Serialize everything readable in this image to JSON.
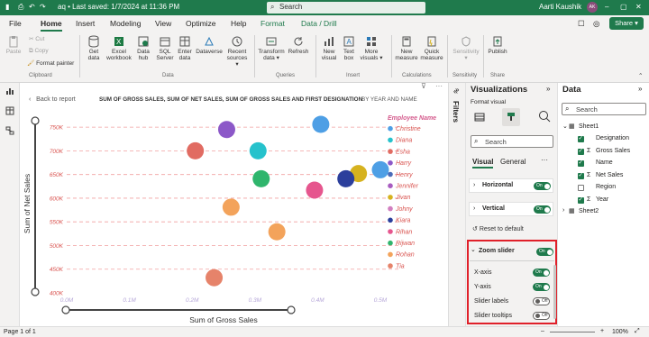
{
  "titlebar": {
    "doc_title": "aq • Last saved: 1/7/2024 at 11:36 PM",
    "search_label": "Search",
    "user_name": "Aarti Kaushik",
    "user_initials": "AK"
  },
  "menu": {
    "tabs": [
      "File",
      "Home",
      "Insert",
      "Modeling",
      "View",
      "Optimize",
      "Help",
      "Format",
      "Data / Drill"
    ],
    "active": "Home",
    "share_label": "Share"
  },
  "ribbon": {
    "clipboard": {
      "paste": "Paste",
      "cut": "Cut",
      "copy": "Copy",
      "format_painter": "Format painter",
      "group": "Clipboard"
    },
    "data": {
      "get_data": "Get data",
      "excel": "Excel workbook",
      "data_hub": "Data hub",
      "sql": "SQL Server",
      "enter": "Enter data",
      "dataverse": "Dataverse",
      "recent": "Recent sources",
      "group": "Data"
    },
    "queries": {
      "transform": "Transform data",
      "refresh": "Refresh",
      "group": "Queries"
    },
    "insert": {
      "new_visual": "New visual",
      "text_box": "Text box",
      "more_visuals": "More visuals",
      "group": "Insert"
    },
    "calculations": {
      "new_measure": "New measure",
      "quick_measure": "Quick measure",
      "group": "Calculations"
    },
    "sensitivity": {
      "label": "Sensitivity",
      "group": "Sensitivity"
    },
    "share": {
      "publish": "Publish",
      "group": "Share"
    }
  },
  "visual": {
    "back": "Back to report",
    "title": "SUM OF GROSS SALES, SUM OF NET SALES, SUM OF GROSS SALES AND FIRST DESIGNATION",
    "subtitle": "BY YEAR AND NAME"
  },
  "chart_data": {
    "type": "scatter",
    "xlabel": "Sum of Gross Sales",
    "ylabel": "Sum of Net Sales",
    "x_ticks": [
      "0.0M",
      "0.1M",
      "0.2M",
      "0.3M",
      "0.4M",
      "0.5M"
    ],
    "y_ticks": [
      "400K",
      "450K",
      "500K",
      "550K",
      "600K",
      "650K",
      "700K",
      "750K"
    ],
    "xlim": [
      0,
      0.5
    ],
    "ylim": [
      400,
      775
    ],
    "legend_title": "Employee Name",
    "legend": [
      {
        "name": "Christine",
        "color": "#4e9fe5"
      },
      {
        "name": "Diana",
        "color": "#26c2cc"
      },
      {
        "name": "Esha",
        "color": "#e16b62"
      },
      {
        "name": "Harry",
        "color": "#8c58c8"
      },
      {
        "name": "Henry",
        "color": "#4a6bb8"
      },
      {
        "name": "Jennifer",
        "color": "#a85cc0"
      },
      {
        "name": "Jivan",
        "color": "#d6b21f"
      },
      {
        "name": "Johny",
        "color": "#d27fc0"
      },
      {
        "name": "Kiara",
        "color": "#2c3f9c"
      },
      {
        "name": "Rihan",
        "color": "#e6568e"
      },
      {
        "name": "Rijwan",
        "color": "#2fb56c"
      },
      {
        "name": "Rohan",
        "color": "#f3a35b"
      },
      {
        "name": "Tia",
        "color": "#e6836a"
      }
    ],
    "points": [
      {
        "name": "Christine",
        "x": 0.405,
        "y": 756
      },
      {
        "name": "Harry",
        "x": 0.255,
        "y": 745
      },
      {
        "name": "Esha",
        "x": 0.205,
        "y": 700
      },
      {
        "name": "Diana",
        "x": 0.305,
        "y": 700
      },
      {
        "name": "Rijwan",
        "x": 0.31,
        "y": 641
      },
      {
        "name": "Jivan",
        "x": 0.465,
        "y": 652
      },
      {
        "name": "Kiara",
        "x": 0.445,
        "y": 641
      },
      {
        "name": "Rihan",
        "x": 0.395,
        "y": 617
      },
      {
        "name": "Christine",
        "x": 0.5,
        "y": 660
      },
      {
        "name": "Rohan",
        "x": 0.262,
        "y": 581
      },
      {
        "name": "Rohan",
        "x": 0.335,
        "y": 529
      },
      {
        "name": "Tia",
        "x": 0.235,
        "y": 432
      }
    ],
    "grid": true,
    "legend_position": "right"
  },
  "filters_label": "Filters",
  "viz_pane": {
    "title": "Visualizations",
    "format_visual": "Format visual",
    "search": "Search",
    "tab_visual": "Visual",
    "tab_general": "General",
    "more": "···",
    "sections": [
      {
        "label": "Horizontal",
        "state": "On"
      },
      {
        "label": "Vertical",
        "state": "On"
      }
    ],
    "reset": "Reset to default",
    "zoom": {
      "label": "Zoom slider",
      "state": "On",
      "options": [
        {
          "label": "X-axis",
          "state": "On"
        },
        {
          "label": "Y-axis",
          "state": "On"
        },
        {
          "label": "Slider labels",
          "state": "Off"
        },
        {
          "label": "Slider tooltips",
          "state": "Off"
        }
      ]
    }
  },
  "data_pane": {
    "title": "Data",
    "search": "Search",
    "table1": "Sheet1",
    "fields": [
      {
        "name": "Designation",
        "checked": true,
        "sigma": false
      },
      {
        "name": "Gross Sales",
        "checked": true,
        "sigma": true
      },
      {
        "name": "Name",
        "checked": true,
        "sigma": false
      },
      {
        "name": "Net Sales",
        "checked": true,
        "sigma": true
      },
      {
        "name": "Region",
        "checked": false,
        "sigma": false
      },
      {
        "name": "Year",
        "checked": true,
        "sigma": true
      }
    ],
    "table2": "Sheet2"
  },
  "status": {
    "page": "Page 1 of 1",
    "zoom": "100%"
  },
  "colors": {
    "brand": "#1f7a4c",
    "highlight_box": "#e0202a"
  }
}
